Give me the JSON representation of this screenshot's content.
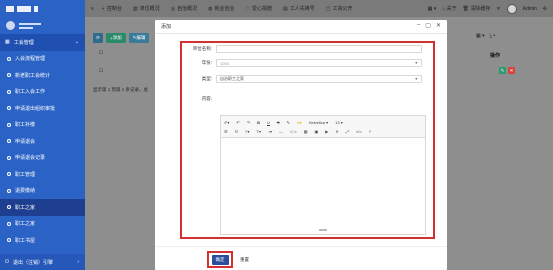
{
  "sidebar": {
    "section_title": "工会管理",
    "items": [
      {
        "label": "入会流程管理"
      },
      {
        "label": "新老职工会统计"
      },
      {
        "label": "职工入会工作"
      },
      {
        "label": "申请退出组织审批"
      },
      {
        "label": "职工补缴"
      },
      {
        "label": "申请退会"
      },
      {
        "label": "申请退会记录"
      },
      {
        "label": "职工管理"
      },
      {
        "label": "退费缴纳"
      },
      {
        "label": "职工之家",
        "active": true
      },
      {
        "label": "职工之家"
      },
      {
        "label": "职工书屋"
      }
    ],
    "footer": "退出（注销）引擎"
  },
  "topbar": {
    "items": [
      "控制台",
      "单位概况",
      "自治概况",
      "就业创业",
      "爱心捐赠",
      "工人先锋号",
      "工资公开"
    ],
    "right": [
      "关于",
      "清除缓存"
    ],
    "user": "Admin"
  },
  "background": {
    "add_label": "添加",
    "edit_label": "编辑",
    "summary": "显示第 1 到第 1 条记录，总",
    "ops_header": "操作"
  },
  "modal": {
    "title": "添加",
    "fields": {
      "unit_name": {
        "label": "单位名称:",
        "value": ""
      },
      "year": {
        "label": "年份:",
        "value": "1000"
      },
      "type": {
        "label": "类型:",
        "value": "自治职工之家"
      },
      "content": {
        "label": "内容:"
      }
    },
    "editor": {
      "font": "Helvetica",
      "size": "13"
    },
    "ok_label": "确定",
    "reset_label": "重置"
  }
}
